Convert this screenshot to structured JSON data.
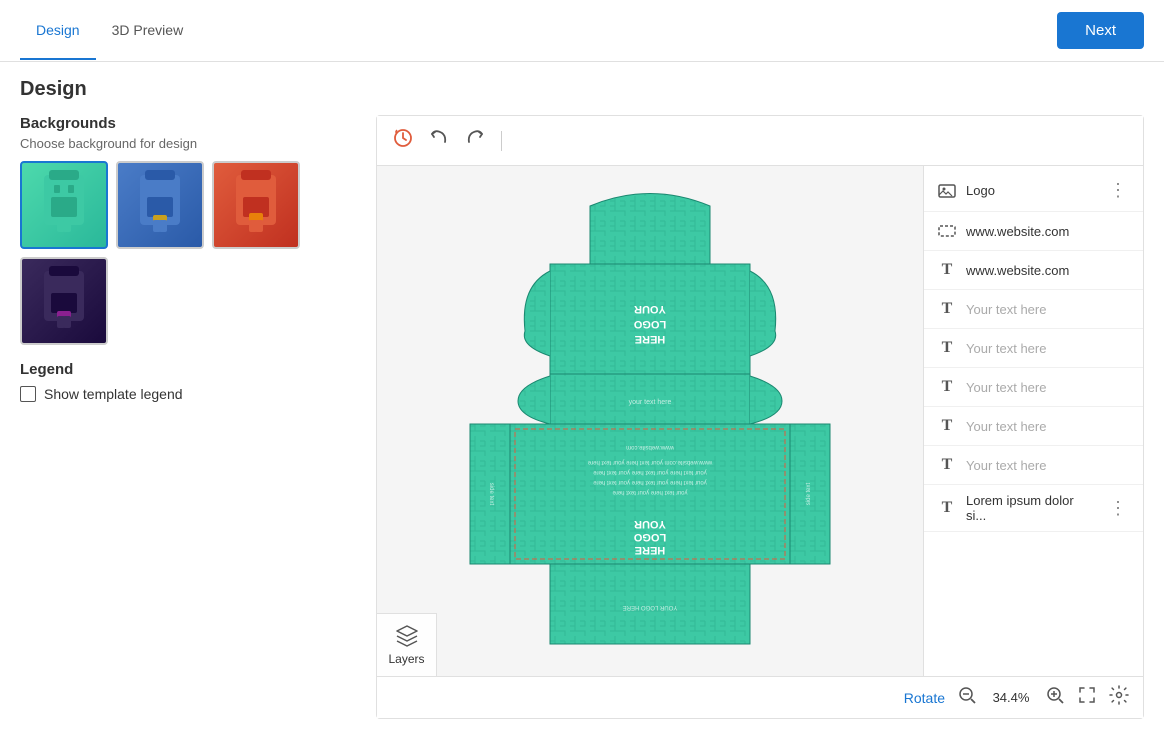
{
  "header": {
    "tab_design": "Design",
    "tab_3d": "3D Preview",
    "btn_next": "Next"
  },
  "page": {
    "title": "Design"
  },
  "sidebar": {
    "backgrounds_title": "Backgrounds",
    "backgrounds_sub": "Choose background for design",
    "backgrounds": [
      {
        "id": "bg1",
        "color": "teal",
        "selected": true
      },
      {
        "id": "bg2",
        "color": "blue",
        "selected": false
      },
      {
        "id": "bg3",
        "color": "red",
        "selected": false
      },
      {
        "id": "bg4",
        "color": "dark",
        "selected": false
      }
    ],
    "legend_title": "Legend",
    "legend_checkbox_label": "Show template legend",
    "legend_checked": false
  },
  "canvas": {
    "zoom_level": "34.4%",
    "rotate_label": "Rotate"
  },
  "layers": {
    "button_label": "Layers"
  },
  "right_panel": {
    "items": [
      {
        "id": "logo",
        "type": "image",
        "label": "Logo",
        "has_more": true,
        "placeholder": false
      },
      {
        "id": "website",
        "type": "dashed",
        "label": "www.website.com",
        "has_more": false,
        "placeholder": false
      },
      {
        "id": "website2",
        "type": "T",
        "label": "www.website.com",
        "has_more": false,
        "placeholder": false
      },
      {
        "id": "text1",
        "type": "T",
        "label": "Your text here",
        "has_more": false,
        "placeholder": true
      },
      {
        "id": "text2",
        "type": "T",
        "label": "Your text here",
        "has_more": false,
        "placeholder": true
      },
      {
        "id": "text3",
        "type": "T",
        "label": "Your text here",
        "has_more": false,
        "placeholder": true
      },
      {
        "id": "text4",
        "type": "T",
        "label": "Your text here",
        "has_more": false,
        "placeholder": true
      },
      {
        "id": "text5",
        "type": "T",
        "label": "Your text here",
        "has_more": false,
        "placeholder": true
      },
      {
        "id": "lorem",
        "type": "T",
        "label": "Lorem ipsum dolor si...",
        "has_more": true,
        "placeholder": false
      }
    ]
  }
}
